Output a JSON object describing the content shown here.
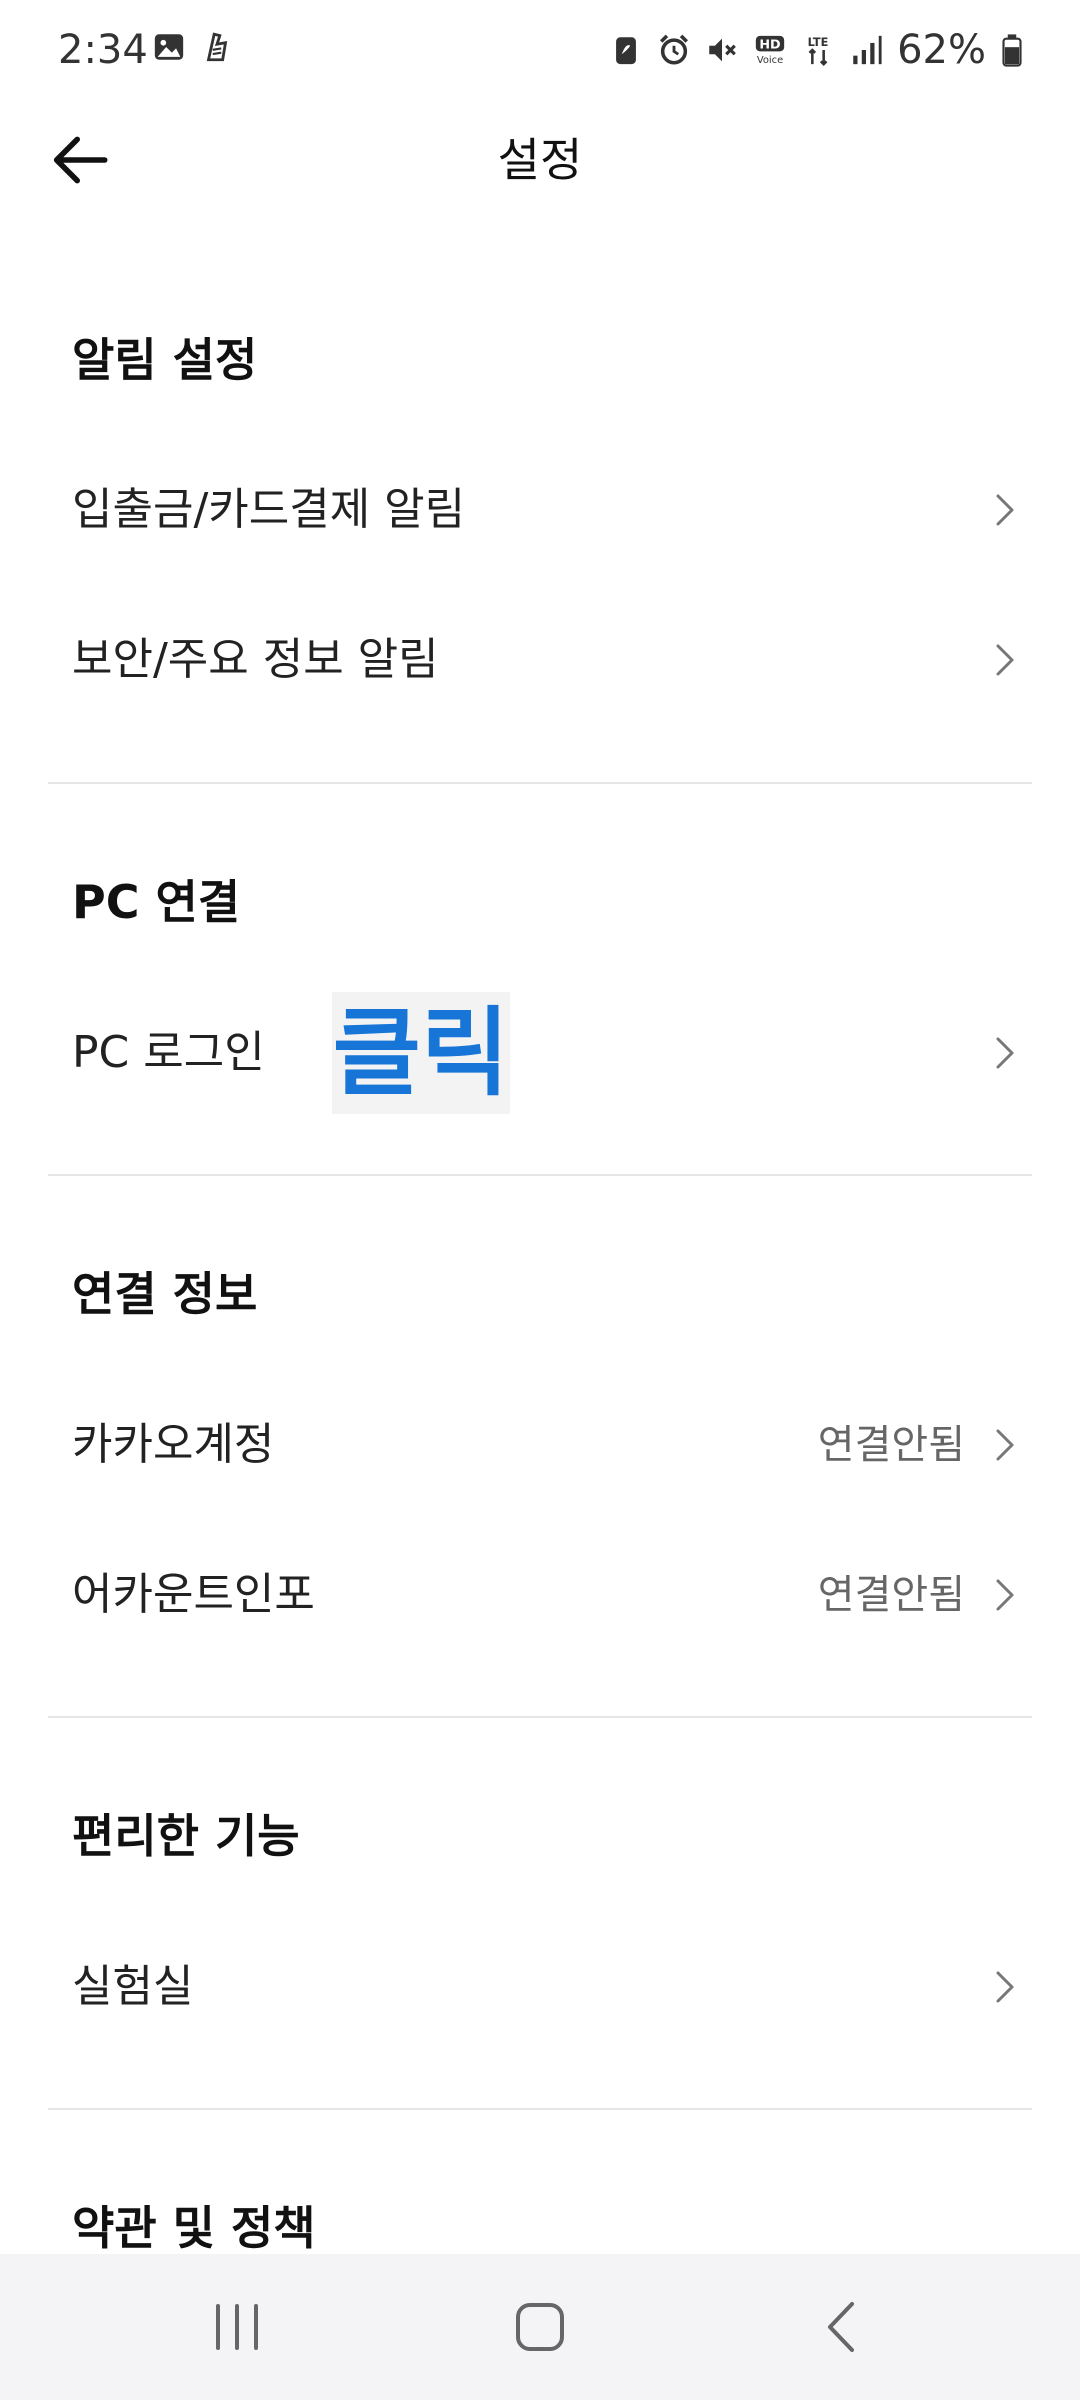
{
  "status_bar": {
    "time": "2:34",
    "battery_percent": "62%",
    "left_icons": [
      "gallery-icon",
      "app-notification-icon"
    ],
    "right_icons": [
      "battery-saver-icon",
      "alarm-icon",
      "mute-icon",
      "hd-voice-icon",
      "lte-icon",
      "signal-icon",
      "battery-icon"
    ]
  },
  "header": {
    "title": "설정"
  },
  "sections": {
    "alarm": {
      "title": "알림 설정",
      "items": [
        {
          "label": "입출금/카드결제 알림"
        },
        {
          "label": "보안/주요 정보 알림"
        }
      ]
    },
    "pc": {
      "title": "PC 연결",
      "items": [
        {
          "label": "PC 로그인"
        }
      ]
    },
    "connection": {
      "title": "연결 정보",
      "items": [
        {
          "label": "카카오계정",
          "value": "연결안됨"
        },
        {
          "label": "어카운트인포",
          "value": "연결안됨"
        }
      ]
    },
    "convenience": {
      "title": "편리한 기능",
      "items": [
        {
          "label": "실험실"
        }
      ]
    },
    "terms": {
      "title": "약관 및 정책"
    }
  },
  "annotation": {
    "text": "클릭",
    "color": "#1675d6"
  },
  "nav": {
    "icons": [
      "recent-apps-icon",
      "home-icon",
      "back-nav-icon"
    ]
  }
}
